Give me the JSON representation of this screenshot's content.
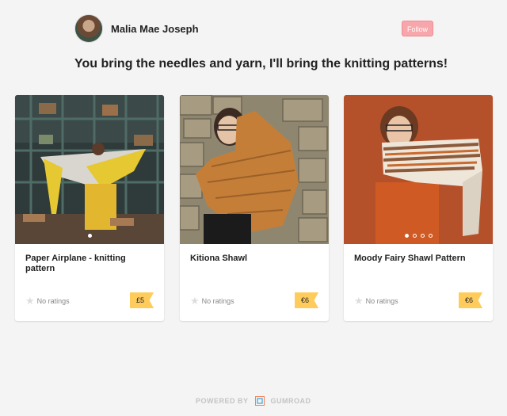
{
  "profile": {
    "name": "Malia Mae Joseph",
    "follow_label": "Follow"
  },
  "tagline": "You bring the needles and yarn, I'll bring the knitting patterns!",
  "products": [
    {
      "title": "Paper Airplane - knitting pattern",
      "rating": "No ratings",
      "price": "£5",
      "image_icon": "shawl-photo-icon"
    },
    {
      "title": "Kitiona Shawl",
      "rating": "No ratings",
      "price": "€6",
      "image_icon": "shawl-photo-icon"
    },
    {
      "title": "Moody Fairy Shawl Pattern",
      "rating": "No ratings",
      "price": "€6",
      "image_icon": "shawl-photo-icon"
    }
  ],
  "footer": {
    "powered_by": "POWERED BY",
    "brand": "GUMROAD"
  },
  "colors": {
    "accent": "#f7a7ab",
    "price_tag": "#ffcb5b",
    "background": "#f4f4f4"
  }
}
